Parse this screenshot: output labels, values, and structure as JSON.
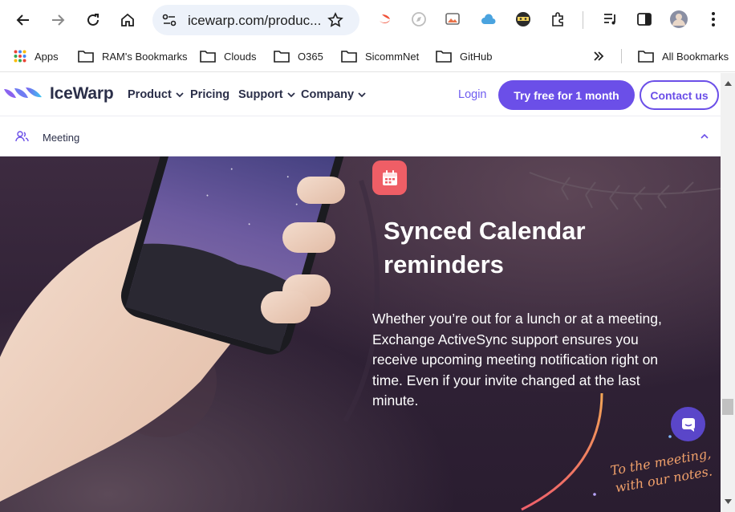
{
  "browser": {
    "url": "icewarp.com/produc...",
    "bookmarks": {
      "apps": "Apps",
      "items": [
        "RAM's Bookmarks",
        "Clouds",
        "O365",
        "SicommNet",
        "GitHub"
      ],
      "all": "All Bookmarks"
    }
  },
  "site": {
    "brand": "IceWarp",
    "menu": {
      "product": "Product",
      "pricing": "Pricing",
      "support": "Support",
      "company": "Company"
    },
    "login": "Login",
    "try_button": "Try free for 1 month",
    "contact_button": "Contact us",
    "subnav_label": "Meeting"
  },
  "hero": {
    "title": "Synced Calendar reminders",
    "body": "Whether you’re out for a lunch or at a meeting, Exchange ActiveSync support ensures you receive upcoming meeting notification right on time. Even if your invite changed at the last minute.",
    "note_line1": "To the meeting,",
    "note_line2": "with our notes."
  },
  "colors": {
    "accent": "#6b4fe8",
    "calendar_badge": "#ef5e66",
    "hero_bg": "#2f2135"
  }
}
